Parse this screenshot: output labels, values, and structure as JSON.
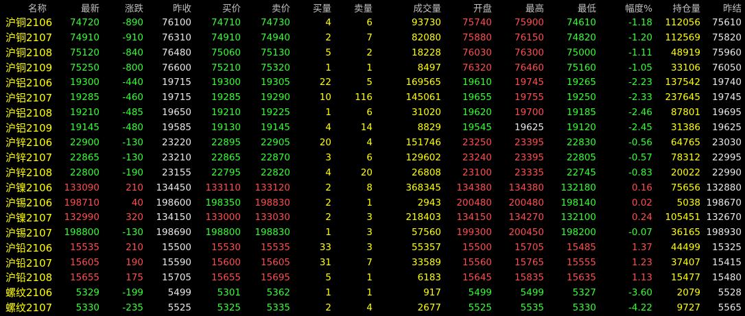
{
  "headers": [
    "名称",
    "最新",
    "涨跌",
    "昨收",
    "买价",
    "卖价",
    "买量",
    "卖量",
    "成交量",
    "开盘",
    "最高",
    "最低",
    "幅度%",
    "持仓量",
    "昨结"
  ],
  "rows": [
    {
      "name": "沪铜2106",
      "last": "74720",
      "chg": "-890",
      "prev_close": "76100",
      "bid": "74710",
      "ask": "74730",
      "bid_vol": "4",
      "ask_vol": "6",
      "volume": "93730",
      "open": "75740",
      "high": "75900",
      "low": "74610",
      "pct": "-1.18",
      "oi": "112056",
      "prev_settle": "75610"
    },
    {
      "name": "沪铜2107",
      "last": "74910",
      "chg": "-910",
      "prev_close": "76310",
      "bid": "74910",
      "ask": "74940",
      "bid_vol": "2",
      "ask_vol": "7",
      "volume": "82080",
      "open": "75880",
      "high": "76150",
      "low": "74820",
      "pct": "-1.20",
      "oi": "112569",
      "prev_settle": "75820"
    },
    {
      "name": "沪铜2108",
      "last": "75120",
      "chg": "-840",
      "prev_close": "76480",
      "bid": "75060",
      "ask": "75130",
      "bid_vol": "5",
      "ask_vol": "2",
      "volume": "18228",
      "open": "76030",
      "high": "76300",
      "low": "75000",
      "pct": "-1.11",
      "oi": "48919",
      "prev_settle": "75960"
    },
    {
      "name": "沪铜2109",
      "last": "75250",
      "chg": "-800",
      "prev_close": "76600",
      "bid": "75210",
      "ask": "75320",
      "bid_vol": "1",
      "ask_vol": "1",
      "volume": "8497",
      "open": "76320",
      "high": "76460",
      "low": "75160",
      "pct": "-1.05",
      "oi": "33106",
      "prev_settle": "76050"
    },
    {
      "name": "沪铝2106",
      "last": "19300",
      "chg": "-440",
      "prev_close": "19715",
      "bid": "19300",
      "ask": "19305",
      "bid_vol": "22",
      "ask_vol": "5",
      "volume": "169565",
      "open": "19610",
      "high": "19745",
      "low": "19265",
      "pct": "-2.23",
      "oi": "137542",
      "prev_settle": "19740"
    },
    {
      "name": "沪铝2107",
      "last": "19285",
      "chg": "-460",
      "prev_close": "19715",
      "bid": "19285",
      "ask": "19290",
      "bid_vol": "10",
      "ask_vol": "116",
      "volume": "145061",
      "open": "19655",
      "high": "19755",
      "low": "19250",
      "pct": "-2.33",
      "oi": "237645",
      "prev_settle": "19745"
    },
    {
      "name": "沪铝2108",
      "last": "19210",
      "chg": "-485",
      "prev_close": "19650",
      "bid": "19210",
      "ask": "19225",
      "bid_vol": "1",
      "ask_vol": "6",
      "volume": "31020",
      "open": "19620",
      "high": "19700",
      "low": "19185",
      "pct": "-2.46",
      "oi": "87801",
      "prev_settle": "19695"
    },
    {
      "name": "沪铝2109",
      "last": "19145",
      "chg": "-480",
      "prev_close": "19585",
      "bid": "19130",
      "ask": "19145",
      "bid_vol": "4",
      "ask_vol": "14",
      "volume": "8829",
      "open": "19545",
      "high": "19625",
      "low": "19120",
      "pct": "-2.45",
      "oi": "31386",
      "prev_settle": "19625"
    },
    {
      "name": "沪锌2106",
      "last": "22900",
      "chg": "-130",
      "prev_close": "23220",
      "bid": "22895",
      "ask": "22905",
      "bid_vol": "20",
      "ask_vol": "4",
      "volume": "151746",
      "open": "23250",
      "high": "23395",
      "low": "22830",
      "pct": "-0.56",
      "oi": "64765",
      "prev_settle": "23030"
    },
    {
      "name": "沪锌2107",
      "last": "22865",
      "chg": "-130",
      "prev_close": "23210",
      "bid": "22865",
      "ask": "22870",
      "bid_vol": "3",
      "ask_vol": "6",
      "volume": "129602",
      "open": "23240",
      "high": "23395",
      "low": "22805",
      "pct": "-0.57",
      "oi": "78312",
      "prev_settle": "22995"
    },
    {
      "name": "沪锌2108",
      "last": "22800",
      "chg": "-190",
      "prev_close": "23155",
      "bid": "22795",
      "ask": "22820",
      "bid_vol": "4",
      "ask_vol": "20",
      "volume": "26808",
      "open": "23100",
      "high": "23335",
      "low": "22745",
      "pct": "-0.83",
      "oi": "20022",
      "prev_settle": "22990"
    },
    {
      "name": "沪镍2106",
      "last": "133090",
      "chg": "210",
      "prev_close": "134450",
      "bid": "133110",
      "ask": "133120",
      "bid_vol": "2",
      "ask_vol": "8",
      "volume": "368345",
      "open": "134380",
      "high": "134380",
      "low": "132180",
      "pct": "0.16",
      "oi": "75656",
      "prev_settle": "132880"
    },
    {
      "name": "沪锡2106",
      "last": "198710",
      "chg": "40",
      "prev_close": "198600",
      "bid": "198350",
      "ask": "198830",
      "bid_vol": "2",
      "ask_vol": "1",
      "volume": "2943",
      "open": "200480",
      "high": "200480",
      "low": "198140",
      "pct": "0.02",
      "oi": "5038",
      "prev_settle": "198670"
    },
    {
      "name": "沪镍2107",
      "last": "132990",
      "chg": "320",
      "prev_close": "134150",
      "bid": "133000",
      "ask": "133030",
      "bid_vol": "2",
      "ask_vol": "3",
      "volume": "218403",
      "open": "134150",
      "high": "134270",
      "low": "132100",
      "pct": "0.24",
      "oi": "105451",
      "prev_settle": "132670"
    },
    {
      "name": "沪锡2107",
      "last": "198800",
      "chg": "-130",
      "prev_close": "198690",
      "bid": "198800",
      "ask": "198830",
      "bid_vol": "1",
      "ask_vol": "3",
      "volume": "57560",
      "open": "199300",
      "high": "200450",
      "low": "198200",
      "pct": "-0.07",
      "oi": "36165",
      "prev_settle": "198930"
    },
    {
      "name": "沪铅2106",
      "last": "15535",
      "chg": "210",
      "prev_close": "15500",
      "bid": "15530",
      "ask": "15535",
      "bid_vol": "33",
      "ask_vol": "3",
      "volume": "55357",
      "open": "15500",
      "high": "15705",
      "low": "15485",
      "pct": "1.37",
      "oi": "44499",
      "prev_settle": "15325"
    },
    {
      "name": "沪铅2107",
      "last": "15605",
      "chg": "190",
      "prev_close": "15590",
      "bid": "15600",
      "ask": "15605",
      "bid_vol": "31",
      "ask_vol": "7",
      "volume": "33589",
      "open": "15560",
      "high": "15765",
      "low": "15555",
      "pct": "1.23",
      "oi": "37407",
      "prev_settle": "15415"
    },
    {
      "name": "沪铅2108",
      "last": "15655",
      "chg": "175",
      "prev_close": "15705",
      "bid": "15655",
      "ask": "15695",
      "bid_vol": "5",
      "ask_vol": "1",
      "volume": "6183",
      "open": "15645",
      "high": "15835",
      "low": "15635",
      "pct": "1.13",
      "oi": "15477",
      "prev_settle": "15480"
    },
    {
      "name": "螺纹2106",
      "last": "5329",
      "chg": "-199",
      "prev_close": "5499",
      "bid": "5301",
      "ask": "5362",
      "bid_vol": "1",
      "ask_vol": "1",
      "volume": "917",
      "open": "5499",
      "high": "5499",
      "low": "5327",
      "pct": "-3.60",
      "oi": "2079",
      "prev_settle": "5528"
    },
    {
      "name": "螺纹2107",
      "last": "5330",
      "chg": "-235",
      "prev_close": "5525",
      "bid": "5325",
      "ask": "5335",
      "bid_vol": "2",
      "ask_vol": "4",
      "volume": "2677",
      "open": "5525",
      "high": "5535",
      "low": "5330",
      "pct": "-4.22",
      "oi": "9727",
      "prev_settle": "5565"
    }
  ]
}
